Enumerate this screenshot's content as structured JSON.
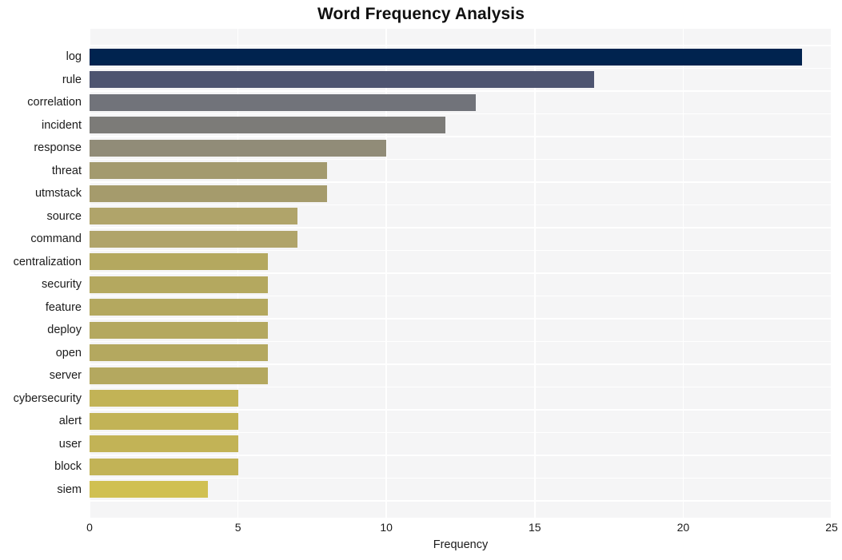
{
  "chart_data": {
    "type": "bar",
    "orientation": "horizontal",
    "title": "Word Frequency Analysis",
    "xlabel": "Frequency",
    "ylabel": "",
    "xlim": [
      0,
      25
    ],
    "xticks": [
      0,
      5,
      10,
      15,
      20,
      25
    ],
    "grid": true,
    "legend": null,
    "categories": [
      "log",
      "rule",
      "correlation",
      "incident",
      "response",
      "threat",
      "utmstack",
      "source",
      "command",
      "centralization",
      "security",
      "feature",
      "deploy",
      "open",
      "server",
      "cybersecurity",
      "alert",
      "user",
      "block",
      "siem"
    ],
    "values": [
      24,
      17,
      13,
      12,
      10,
      8,
      8,
      7,
      7,
      6,
      6,
      6,
      6,
      6,
      6,
      5,
      5,
      5,
      5,
      4
    ],
    "bar_colors": [
      "#00234f",
      "#4d5470",
      "#71737a",
      "#7c7b78",
      "#918c78",
      "#a39a6e",
      "#a59b6c",
      "#b0a46a",
      "#b0a46a",
      "#b4a85f",
      "#b4a85f",
      "#b4a85f",
      "#b4a85f",
      "#b4a85f",
      "#b4a85f",
      "#c2b356",
      "#c2b356",
      "#c2b356",
      "#c2b356",
      "#d0c052"
    ],
    "plot_background": "#f5f5f6",
    "grid_color": "#ffffff",
    "figure_background": "#ffffff"
  }
}
